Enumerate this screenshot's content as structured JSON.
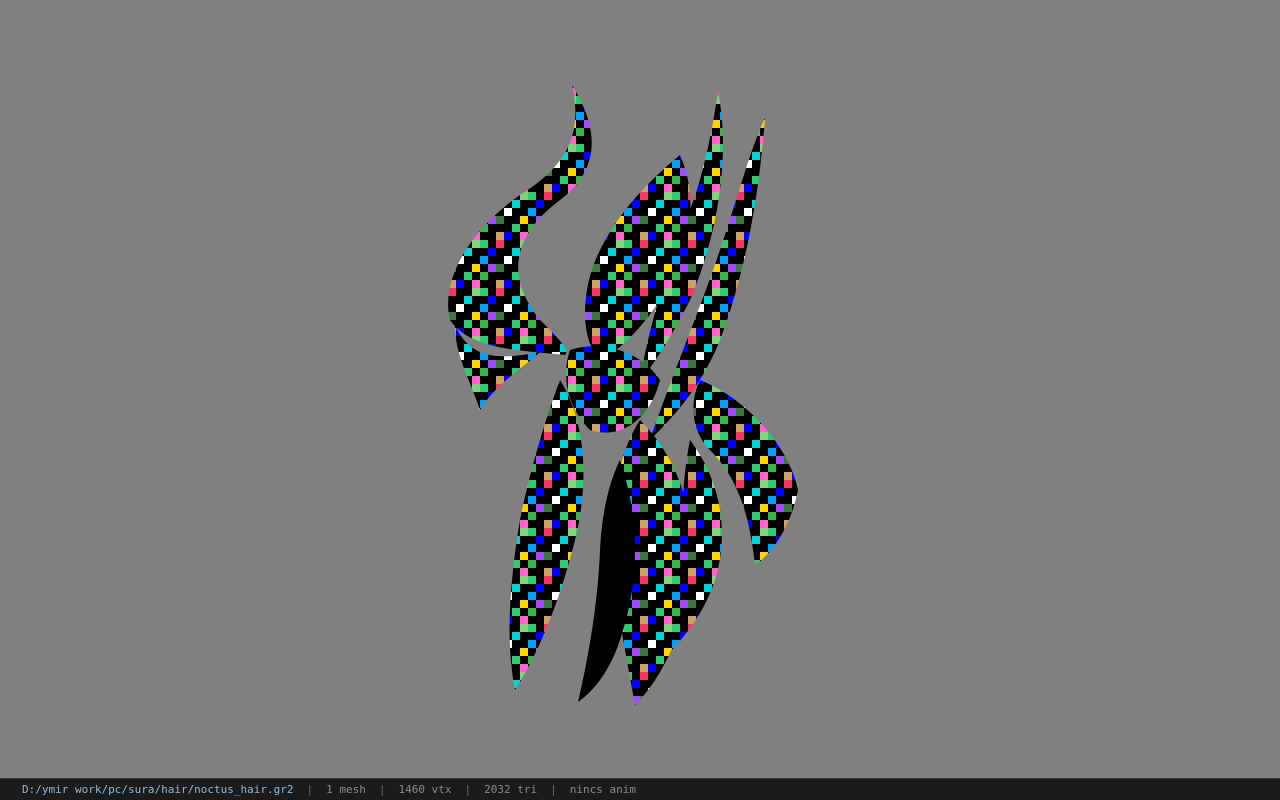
{
  "viewer": {
    "background_color": "#808080"
  },
  "model": {
    "icon_name": "hair-mesh-3d-render",
    "texture_palette": [
      "#000000",
      "#2ecc71",
      "#0000ff",
      "#ff3366",
      "#ffffff",
      "#ffd400",
      "#00d4d4",
      "#a04dff",
      "#d4a060",
      "#39b54a"
    ]
  },
  "statusbar": {
    "file_path": "D:/ymir work/pc/sura/hair/noctus_hair.gr2",
    "mesh_count": "1 mesh",
    "vertex_count": "1460 vtx",
    "triangle_count": "2032 tri",
    "anim_status": "nincs anim",
    "separator": "|"
  }
}
